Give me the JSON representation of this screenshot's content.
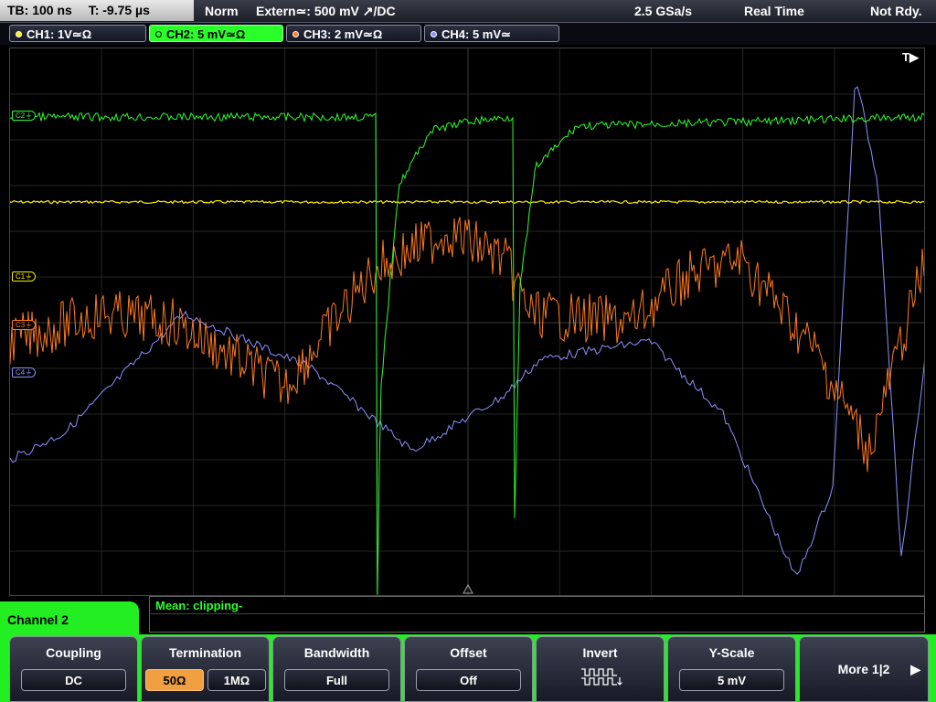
{
  "status": {
    "timebase": "TB: 100 ns",
    "trigger_time": "T: -9.75 µs",
    "mode": "Norm",
    "trigger_source": "Extern≃: 500 mV ↗/DC",
    "sample_rate": "2.5 GSa/s",
    "acquisition": "Real Time",
    "ready_state": "Not Rdy."
  },
  "channels": [
    {
      "label": "CH1: 1V≃Ω",
      "color": "#ffee00"
    },
    {
      "label": "CH2: 5 mV≃Ω",
      "color": "#2aff2a"
    },
    {
      "label": "CH3: 2 mV≃Ω",
      "color": "#ff7a1a"
    },
    {
      "label": "CH4: 5 mV≃",
      "color": "#8f8fff"
    }
  ],
  "screen": {
    "trigger_marker": "T▶",
    "markers": {
      "c2": "C2⏚",
      "c1": "C1⏚",
      "c3": "C3⏚",
      "c4": "C4⏚"
    }
  },
  "measurement": {
    "text": "Mean: clipping-"
  },
  "menu": {
    "title": "Channel 2",
    "coupling": {
      "title": "Coupling",
      "value": "DC"
    },
    "termination": {
      "title": "Termination",
      "opt1": "50Ω",
      "opt2": "1MΩ"
    },
    "bandwidth": {
      "title": "Bandwidth",
      "value": "Full"
    },
    "offset": {
      "title": "Offset",
      "value": "Off"
    },
    "invert": {
      "title": "Invert"
    },
    "yscale": {
      "title": "Y-Scale",
      "value": "5 mV"
    },
    "more": {
      "label": "More 1|2",
      "arrow": "▶"
    }
  }
}
